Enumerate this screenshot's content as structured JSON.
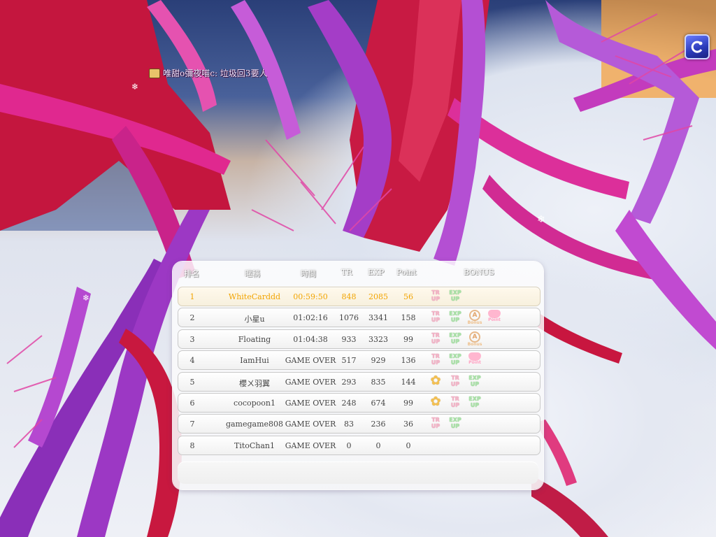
{
  "chat": {
    "message": "唯甜o彌夜喵c: 垃圾回3要人"
  },
  "results": {
    "headers": {
      "rank": "排名",
      "name": "暱稱",
      "time": "時間",
      "tr": "TR",
      "exp": "EXP",
      "point": "Point",
      "bonus": "BONUS"
    },
    "rows": [
      {
        "rank": "1",
        "name": "WhiteCarddd",
        "time": "00:59:50",
        "tr": "848",
        "exp": "2085",
        "point": "56",
        "bonus": [
          "tr-up",
          "exp-up"
        ]
      },
      {
        "rank": "2",
        "name": "小星u",
        "time": "01:02:16",
        "tr": "1076",
        "exp": "3341",
        "point": "158",
        "bonus": [
          "tr-up",
          "exp-up",
          "bonus",
          "point"
        ]
      },
      {
        "rank": "3",
        "name": "Floating",
        "time": "01:04:38",
        "tr": "933",
        "exp": "3323",
        "point": "99",
        "bonus": [
          "tr-up",
          "exp-up",
          "bonus"
        ]
      },
      {
        "rank": "4",
        "name": "IamHui",
        "time": "GAME OVER",
        "tr": "517",
        "exp": "929",
        "point": "136",
        "bonus": [
          "tr-up",
          "exp-up",
          "point"
        ]
      },
      {
        "rank": "5",
        "name": "櫻ㄨ羽翼",
        "time": "GAME OVER",
        "tr": "293",
        "exp": "835",
        "point": "144",
        "bonus": [
          "star",
          "tr-up",
          "exp-up"
        ]
      },
      {
        "rank": "6",
        "name": "cocopoon1",
        "time": "GAME OVER",
        "tr": "248",
        "exp": "674",
        "point": "99",
        "bonus": [
          "star",
          "tr-up",
          "exp-up"
        ]
      },
      {
        "rank": "7",
        "name": "gamegame808",
        "time": "GAME OVER",
        "tr": "83",
        "exp": "236",
        "point": "36",
        "bonus": [
          "tr-up",
          "exp-up"
        ]
      },
      {
        "rank": "8",
        "name": "TitoChan1",
        "time": "GAME OVER",
        "tr": "0",
        "exp": "0",
        "point": "0",
        "bonus": []
      }
    ]
  },
  "badges": {
    "tr-up": {
      "top": "TR",
      "bottom": "UP"
    },
    "exp-up": {
      "top": "EXP",
      "bottom": "UP"
    },
    "bonus": {
      "top": "",
      "bottom": "Bonus"
    },
    "point": {
      "top": "",
      "bottom": "Point"
    },
    "star": {
      "top": "",
      "bottom": ""
    }
  },
  "colors": {
    "first_place": "#f2a400",
    "branch_magenta": "#d81f8f",
    "branch_purple": "#8a2fb8",
    "tree_red": "#c4163e"
  },
  "icons": {
    "corner_button": "swirl-icon",
    "chat_icon": "chat-bubble-icon"
  }
}
